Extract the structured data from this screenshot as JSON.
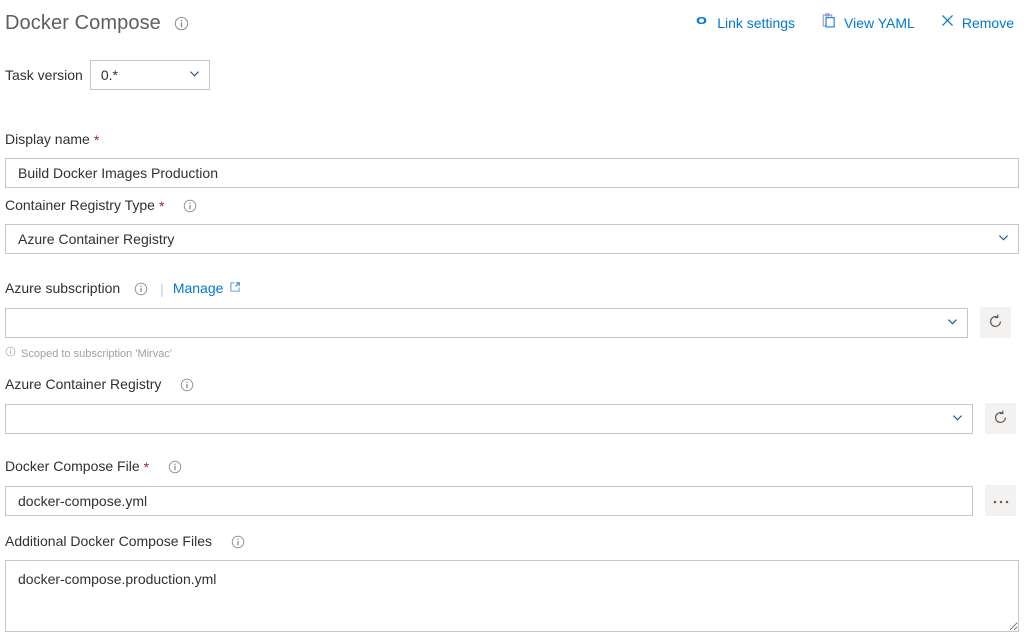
{
  "header": {
    "title": "Docker Compose",
    "info_icon": "info-icon",
    "toolbar": [
      {
        "label": "Link settings",
        "icon": "link-icon"
      },
      {
        "label": "View YAML",
        "icon": "clipboard-icon"
      },
      {
        "label": "Remove",
        "icon": "close-icon"
      }
    ]
  },
  "task_version": {
    "label": "Task version",
    "value": "0.*",
    "chevron_icon": "chevron-down-icon"
  },
  "fields": {
    "display_name": {
      "label": "Display name",
      "required": "*",
      "value": "Build Docker Images Production"
    },
    "container_registry_type": {
      "label": "Container Registry Type",
      "required": "*",
      "info_icon": "info-icon",
      "value": "Azure Container Registry",
      "chevron_icon": "chevron-down-icon"
    },
    "azure_subscription": {
      "label": "Azure subscription",
      "info_icon": "info-icon",
      "separator": "|",
      "manage_label": "Manage",
      "manage_icon": "external-link-icon",
      "value": "",
      "chevron_icon": "chevron-down-icon",
      "refresh_icon": "refresh-icon",
      "hint_icon": "info-icon",
      "hint": "Scoped to subscription 'Mirvac'"
    },
    "azure_container_registry": {
      "label": "Azure Container Registry",
      "info_icon": "info-icon",
      "value": "",
      "chevron_icon": "chevron-down-icon",
      "refresh_icon": "refresh-icon"
    },
    "docker_compose_file": {
      "label": "Docker Compose File",
      "required": "*",
      "info_icon": "info-icon",
      "value": "docker-compose.yml",
      "browse_label": "...",
      "browse_icon": "ellipsis-icon"
    },
    "additional_docker_compose_files": {
      "label": "Additional Docker Compose Files",
      "info_icon": "info-icon",
      "value": "docker-compose.production.yml"
    }
  },
  "colors": {
    "accent": "#0078d4",
    "required": "#a4262c",
    "border": "#c8c6c4",
    "text": "#323130",
    "muted": "#a19f9d",
    "title": "#605e5c",
    "button_bg": "#f3f2f1"
  }
}
